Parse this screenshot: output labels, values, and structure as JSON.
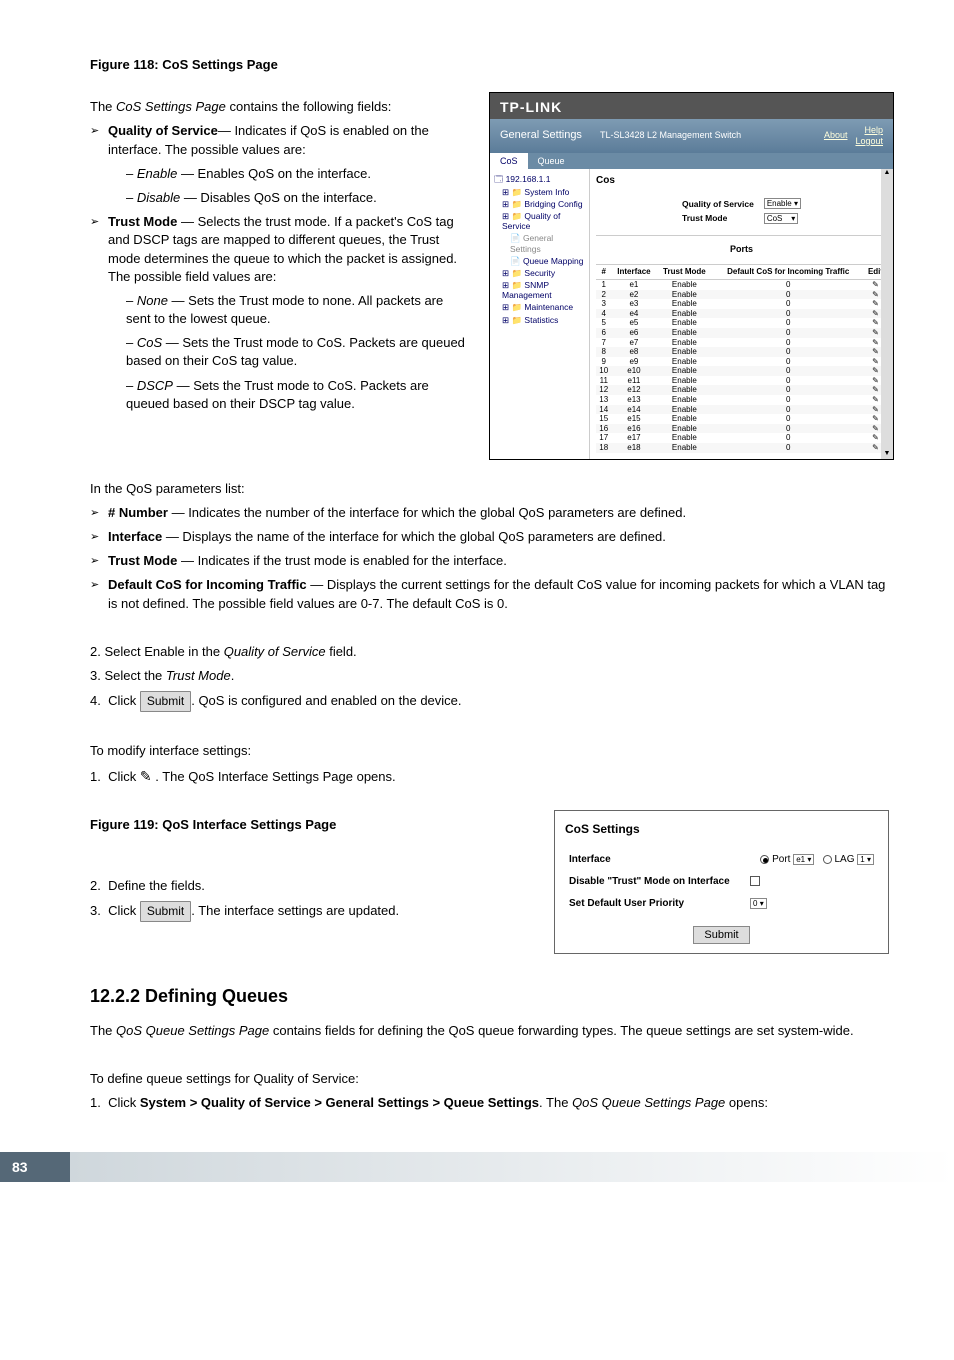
{
  "figure118": {
    "title": "Figure 118: CoS Settings Page",
    "intro_prefix": "The ",
    "intro_italic": "CoS Settings Page",
    "intro_suffix": " contains the following fields:",
    "bullets": [
      {
        "label": "Quality of Service",
        "rest": "— Indicates if QoS is enabled on the interface. The possible values are:",
        "subs": [
          {
            "em": "Enable",
            "rest": " — Enables QoS on the interface."
          },
          {
            "em": "Disable",
            "rest": " — Disables QoS on the interface."
          }
        ]
      },
      {
        "label": "Trust Mode",
        "rest": " — Selects the trust mode. If a packet's CoS tag and DSCP tags are mapped to different queues, the Trust mode determines the queue to which the packet is assigned. The possible field values are:",
        "subs": [
          {
            "em": "None",
            "rest": " — Sets the Trust mode to none. All packets are sent to the lowest queue."
          },
          {
            "em": "CoS",
            "rest": " — Sets the Trust mode to CoS. Packets are queued based on their CoS tag value."
          },
          {
            "em": "DSCP",
            "rest": " — Sets the Trust mode to CoS. Packets are queued based on their DSCP tag value."
          }
        ]
      }
    ]
  },
  "app": {
    "logo": "TP-LINK",
    "header": {
      "section": "General Settings",
      "model": "TL-SL3428 L2 Management Switch",
      "about": "About",
      "help": "Help",
      "logout": "Logout"
    },
    "tabs": {
      "active": "CoS",
      "other": "Queue"
    },
    "tree": {
      "root": "192.168.1.1",
      "items": [
        "System Info",
        "Bridging Config",
        "Quality of Service",
        "General Settings",
        "Queue Mapping",
        "Security",
        "SNMP Management",
        "Maintenance",
        "Statistics"
      ]
    },
    "panel_title": "Cos",
    "form": {
      "qos_label": "Quality of Service",
      "qos_value": "Enable",
      "trust_label": "Trust Mode",
      "trust_value": "CoS"
    },
    "ports_caption": "Ports",
    "ports_headers": [
      "#",
      "Interface",
      "Trust Mode",
      "Default CoS for Incoming Traffic",
      "Edit"
    ],
    "ports": [
      {
        "n": 1,
        "i": "e1",
        "tm": "Enable",
        "c": 0
      },
      {
        "n": 2,
        "i": "e2",
        "tm": "Enable",
        "c": 0
      },
      {
        "n": 3,
        "i": "e3",
        "tm": "Enable",
        "c": 0
      },
      {
        "n": 4,
        "i": "e4",
        "tm": "Enable",
        "c": 0
      },
      {
        "n": 5,
        "i": "e5",
        "tm": "Enable",
        "c": 0
      },
      {
        "n": 6,
        "i": "e6",
        "tm": "Enable",
        "c": 0
      },
      {
        "n": 7,
        "i": "e7",
        "tm": "Enable",
        "c": 0
      },
      {
        "n": 8,
        "i": "e8",
        "tm": "Enable",
        "c": 0
      },
      {
        "n": 9,
        "i": "e9",
        "tm": "Enable",
        "c": 0
      },
      {
        "n": 10,
        "i": "e10",
        "tm": "Enable",
        "c": 0
      },
      {
        "n": 11,
        "i": "e11",
        "tm": "Enable",
        "c": 0
      },
      {
        "n": 12,
        "i": "e12",
        "tm": "Enable",
        "c": 0
      },
      {
        "n": 13,
        "i": "e13",
        "tm": "Enable",
        "c": 0
      },
      {
        "n": 14,
        "i": "e14",
        "tm": "Enable",
        "c": 0
      },
      {
        "n": 15,
        "i": "e15",
        "tm": "Enable",
        "c": 0
      },
      {
        "n": 16,
        "i": "e16",
        "tm": "Enable",
        "c": 0
      },
      {
        "n": 17,
        "i": "e17",
        "tm": "Enable",
        "c": 0
      },
      {
        "n": 18,
        "i": "e18",
        "tm": "Enable",
        "c": 0
      }
    ]
  },
  "param_list": {
    "intro": "In the QoS parameters list:",
    "items": [
      {
        "label": "# Number",
        "rest": " — Indicates the number of the interface for which the global QoS parameters are defined."
      },
      {
        "label": "Interface",
        "rest": " — Displays the name of the interface for which the global QoS parameters are defined."
      },
      {
        "label": "Trust Mode",
        "rest": " — Indicates if the trust mode is enabled for the interface."
      },
      {
        "label": "Default CoS for Incoming Traffic",
        "rest": " — Displays the current settings for the default CoS value for incoming packets for which a VLAN tag is not defined. The possible field values are 0-7. The default CoS is 0."
      }
    ]
  },
  "steps_a": [
    {
      "n": "2.",
      "pre": "Select Enable in the ",
      "em": "Quality of Service",
      "post": " field."
    },
    {
      "n": "3.",
      "pre": "Select the ",
      "em": "Trust Mode",
      "post": "."
    }
  ],
  "step4": {
    "n": "4.",
    "pre": "Click ",
    "btn": "Submit",
    "post": ". QoS is configured and enabled on the device."
  },
  "modify_intro": "To modify interface settings:",
  "step_modify1": {
    "n": "1.",
    "pre": "Click ",
    "post": " . The QoS Interface Settings Page opens."
  },
  "figure119": {
    "title": "Figure 119: QoS Interface Settings Page"
  },
  "steps_b": {
    "s2": "Define the fields.",
    "s3pre": "Click ",
    "s3btn": "Submit",
    "s3post": ". The interface settings are updated."
  },
  "settings_panel": {
    "title": "CoS Settings",
    "row1_label": "Interface",
    "row1_port": "Port",
    "row1_port_val": "e1",
    "row1_lag": "LAG",
    "row1_lag_val": "1",
    "row2_label": "Disable \"Trust\" Mode on Interface",
    "row3_label": "Set Default User Priority",
    "row3_val": "0",
    "submit": "Submit"
  },
  "section1222": {
    "heading": "12.2.2  Defining Queues",
    "p1_pre": "The ",
    "p1_em": "QoS Queue Settings Page",
    "p1_post": " contains fields for defining the QoS queue forwarding types. The queue settings are set system-wide.",
    "p2": "To define queue settings for Quality of Service:",
    "step1_pre": "Click ",
    "step1_bold": "System > Quality of Service > General Settings > Queue Settings",
    "step1_mid": ". The ",
    "step1_em": "QoS Queue Settings Page",
    "step1_post": " opens:"
  },
  "page_number": "83"
}
